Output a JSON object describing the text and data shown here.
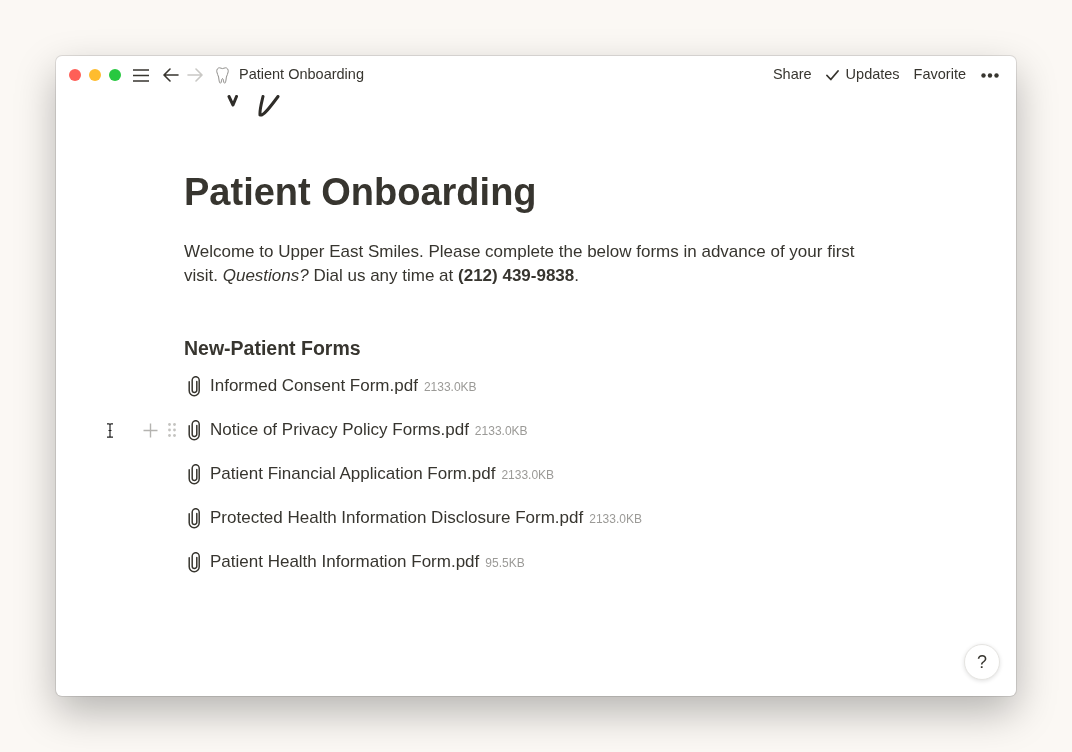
{
  "topbar": {
    "back_enabled": true,
    "forward_enabled": false,
    "breadcrumb": "Patient Onboarding",
    "actions": [
      {
        "label": "Share",
        "kind": "plain"
      },
      {
        "label": "Updates",
        "kind": "checked"
      },
      {
        "label": "Favorite",
        "kind": "plain"
      }
    ]
  },
  "page": {
    "title": "Patient Onboarding",
    "intro": "Welcome to Upper East Smiles. Please complete the below forms in advance of your first visit. *Questions?* Dial us any time at **(212) 439-9838**.",
    "section_heading": "New-Patient Forms",
    "files": [
      {
        "name": "Informed Consent Form.pdf",
        "size": "2133.0KB",
        "hovered": false
      },
      {
        "name": "Notice of Privacy Policy Forms.pdf",
        "size": "2133.0KB",
        "hovered": true
      },
      {
        "name": "Patient Financial Application Form.pdf",
        "size": "2133.0KB",
        "hovered": false
      },
      {
        "name": "Protected Health Information Disclosure Form.pdf",
        "size": "2133.0KB",
        "hovered": false
      },
      {
        "name": "Patient Health Information Form.pdf",
        "size": "95.5KB",
        "hovered": false
      }
    ]
  },
  "help_button": {
    "label": "?"
  }
}
